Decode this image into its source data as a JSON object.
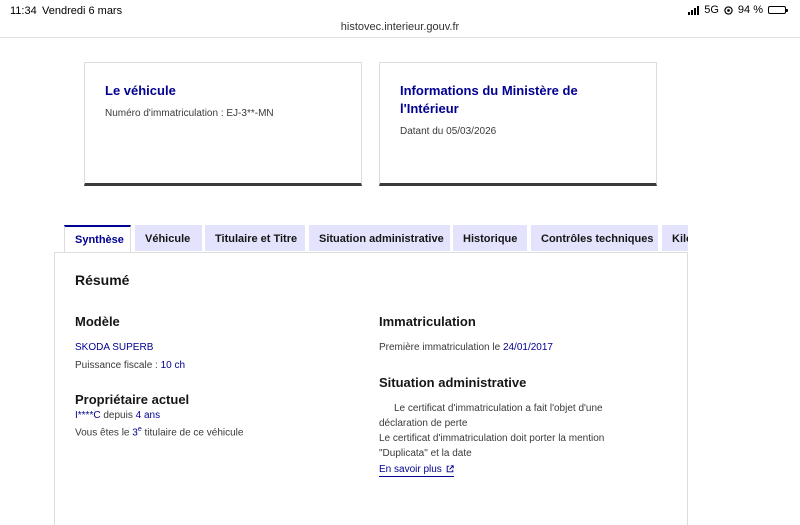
{
  "status": {
    "time": "11:34",
    "date": "Vendredi 6 mars",
    "network": "5G",
    "battery": "94 %",
    "battery_level": 0.94
  },
  "browser": {
    "url": "histovec.interieur.gouv.fr"
  },
  "cards": {
    "vehicule": {
      "title": "Le véhicule",
      "text": "Numéro d'immatriculation : EJ-3**-MN"
    },
    "ministere": {
      "title_line1": "Informations du Ministère de",
      "title_line2": "l'Intérieur",
      "text": "Datant du 05/03/2026"
    }
  },
  "tabs": [
    {
      "label": "Synthèse",
      "active": true
    },
    {
      "label": "Véhicule",
      "active": false
    },
    {
      "label": "Titulaire et Titre",
      "active": false
    },
    {
      "label": "Situation administrative",
      "active": false
    },
    {
      "label": "Historique",
      "active": false
    },
    {
      "label": "Contrôles techniques",
      "active": false
    },
    {
      "label": "Kilo",
      "active": false
    }
  ],
  "resume": {
    "title": "Résumé",
    "modele": {
      "heading": "Modèle",
      "name": "SKODA SUPERB",
      "fiscal_label": "Puissance fiscale : ",
      "fiscal_value": "10 ch"
    },
    "proprietaire": {
      "heading": "Propriétaire actuel",
      "name": "I****C",
      "since_label": " depuis ",
      "since_value": "4 ans",
      "rank_prefix": "Vous êtes le ",
      "rank_number": "3",
      "rank_sup": "e",
      "rank_suffix": " titulaire de ce véhicule"
    },
    "immatriculation": {
      "heading": "Immatriculation",
      "label": "Première immatriculation le ",
      "date": "24/01/2017"
    },
    "situation": {
      "heading": "Situation administrative",
      "line1": "Le certificat d'immatriculation a fait l'objet d'une",
      "line2": "déclaration de perte",
      "line3": "Le certificat d'immatriculation doit porter la mention",
      "line4": "\"Duplicata\" et la date",
      "link": "En savoir plus"
    }
  }
}
